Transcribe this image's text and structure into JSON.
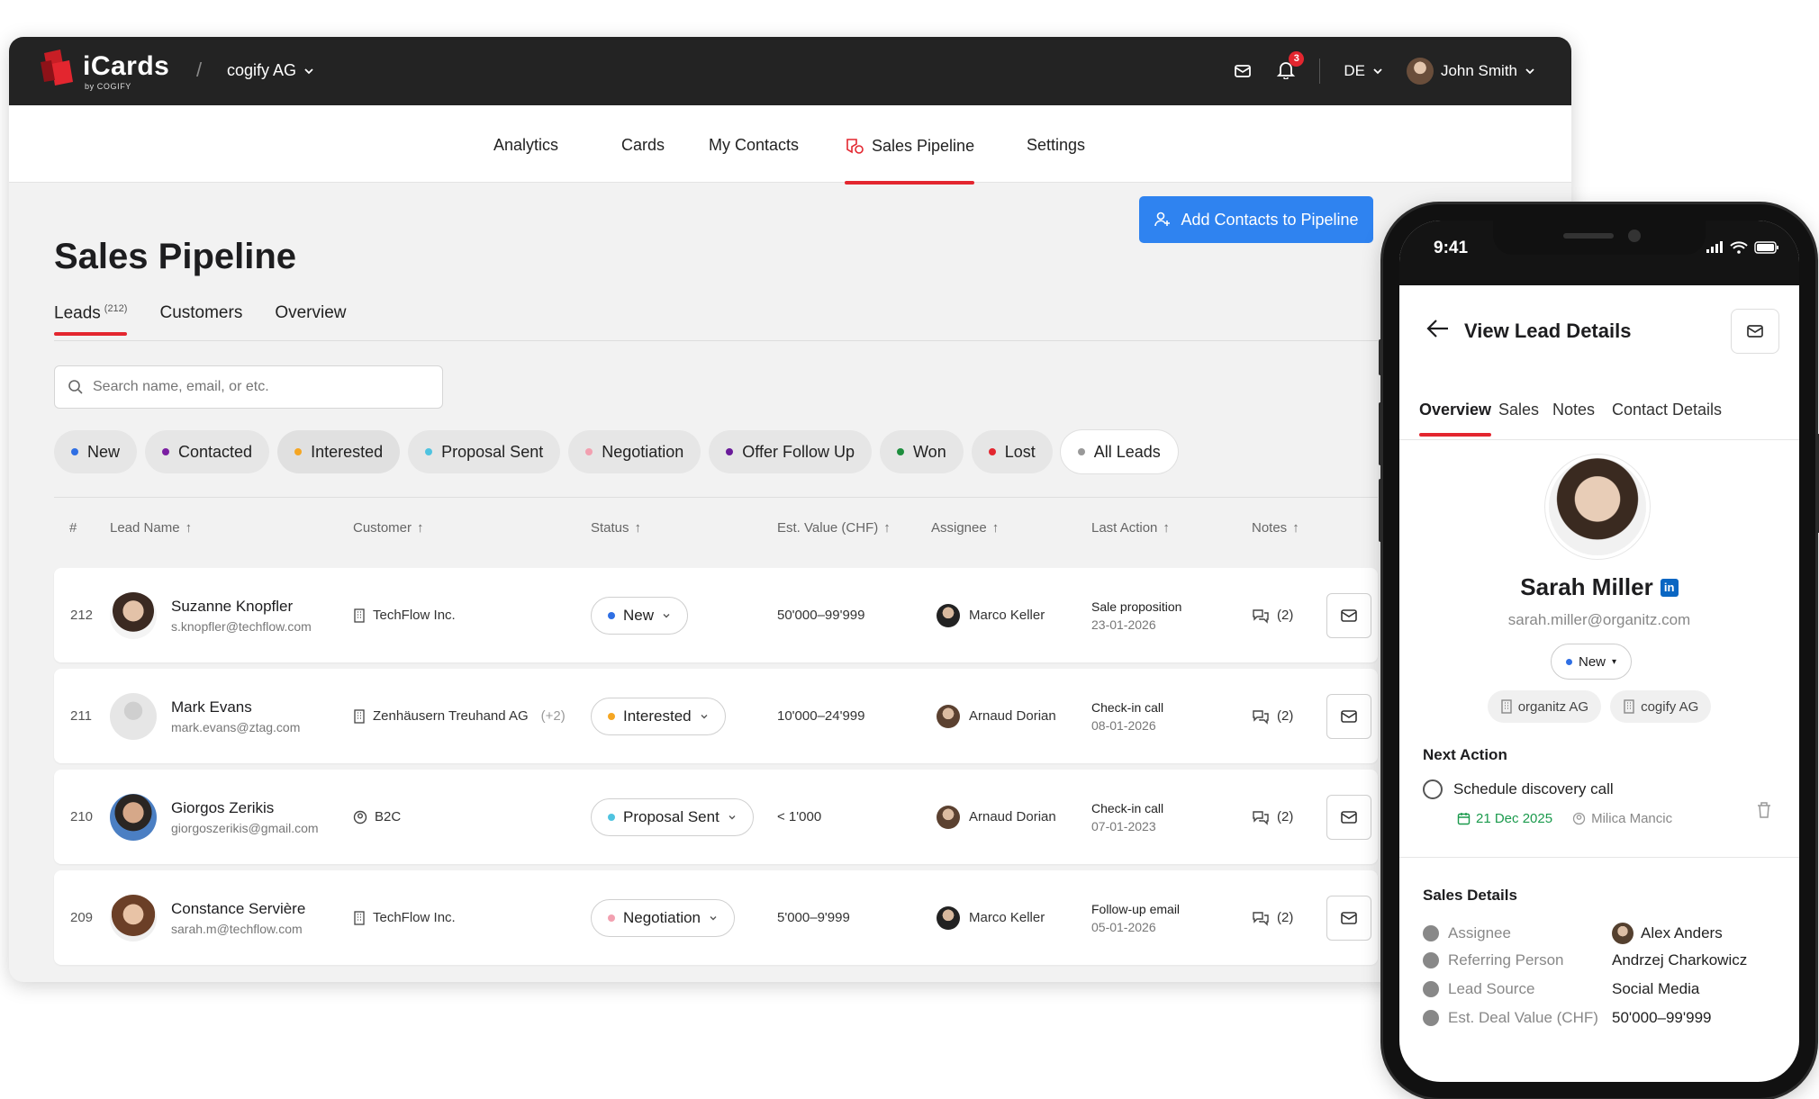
{
  "topbar": {
    "logo": "iCards",
    "logo_sub": "by COGIFY",
    "org": "cogify AG",
    "notifications": "3",
    "lang": "DE",
    "user": "John Smith"
  },
  "nav": [
    {
      "label": "Analytics"
    },
    {
      "label": "Cards"
    },
    {
      "label": "My Contacts"
    },
    {
      "label": "Sales Pipeline"
    },
    {
      "label": "Settings"
    }
  ],
  "page": {
    "title": "Sales Pipeline",
    "add_button": "Add Contacts to Pipeline",
    "subtabs": [
      {
        "label": "Leads",
        "count": "(212)"
      },
      {
        "label": "Customers"
      },
      {
        "label": "Overview"
      }
    ],
    "search_placeholder": "Search name, email, or etc.",
    "chips": [
      {
        "label": "New",
        "color": "#2f6fe4"
      },
      {
        "label": "Contacted",
        "color": "#7b1fa2"
      },
      {
        "label": "Interested",
        "color": "#f5a623"
      },
      {
        "label": "Proposal Sent",
        "color": "#4fc3e0"
      },
      {
        "label": "Negotiation",
        "color": "#f2a0b0"
      },
      {
        "label": "Offer Follow Up",
        "color": "#6a1b9a"
      },
      {
        "label": "Won",
        "color": "#1e8e3e"
      },
      {
        "label": "Lost",
        "color": "#e3262f"
      },
      {
        "label": "All Leads",
        "color": "#999999"
      }
    ],
    "columns": [
      "#",
      "Lead Name",
      "Customer",
      "Status",
      "Est. Value (CHF)",
      "Assignee",
      "Last Action",
      "Notes"
    ],
    "rows": [
      {
        "num": "212",
        "name": "Suzanne Knopfler",
        "email": "s.knopfler@techflow.com",
        "customer": "TechFlow Inc.",
        "customer_extra": "",
        "status": "New",
        "status_color": "#2f6fe4",
        "value": "50'000–99'999",
        "assignee": "Marco Keller",
        "action": "Sale proposition",
        "action_date": "23-01-2026",
        "notes": "(2)"
      },
      {
        "num": "211",
        "name": "Mark Evans",
        "email": "mark.evans@ztag.com",
        "customer": "Zenhäusern Treuhand AG",
        "customer_extra": "(+2)",
        "status": "Interested",
        "status_color": "#f5a623",
        "value": "10'000–24'999",
        "assignee": "Arnaud Dorian",
        "action": "Check-in call",
        "action_date": "08-01-2026",
        "notes": "(2)"
      },
      {
        "num": "210",
        "name": "Giorgos Zerikis",
        "email": "giorgoszerikis@gmail.com",
        "customer": "B2C",
        "customer_extra": "",
        "status": "Proposal Sent",
        "status_color": "#4fc3e0",
        "value": "< 1'000",
        "assignee": "Arnaud Dorian",
        "action": "Check-in call",
        "action_date": "07-01-2023",
        "notes": "(2)"
      },
      {
        "num": "209",
        "name": "Constance Servière",
        "email": "sarah.m@techflow.com",
        "customer": "TechFlow Inc.",
        "customer_extra": "",
        "status": "Negotiation",
        "status_color": "#f2a0b0",
        "value": "5'000–9'999",
        "assignee": "Marco Keller",
        "action": "Follow-up email",
        "action_date": "05-01-2026",
        "notes": "(2)"
      }
    ]
  },
  "phone": {
    "time": "9:41",
    "title": "View Lead Details",
    "tabs": [
      "Overview",
      "Sales",
      "Notes",
      "Contact Details"
    ],
    "name": "Sarah Miller",
    "email": "sarah.miller@organitz.com",
    "status": "New",
    "orgs": [
      "organitz AG",
      "cogify AG"
    ],
    "next_action_heading": "Next Action",
    "task": "Schedule discovery call",
    "task_due": "21 Dec 2025",
    "task_owner": "Milica Mancic",
    "sales_heading": "Sales Details",
    "details": [
      {
        "key": "Assignee",
        "value": "Alex Anders"
      },
      {
        "key": "Referring Person",
        "value": "Andrzej Charkowicz"
      },
      {
        "key": "Lead Source",
        "value": "Social Media"
      },
      {
        "key": "Est. Deal Value (CHF)",
        "value": "50'000–99'999"
      }
    ]
  }
}
